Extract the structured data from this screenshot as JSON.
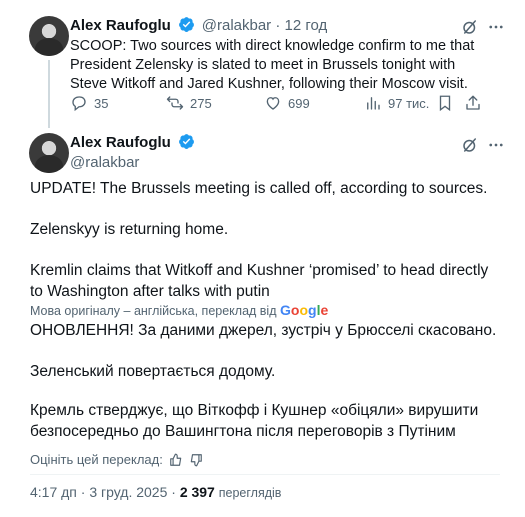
{
  "quoted_tweet": {
    "author_name": "Alex Raufoglu",
    "handle": "@ralakbar",
    "separator": " · ",
    "time": "12 год",
    "text": "SCOOP:  Two sources with direct knowledge confirm to me that President Zelensky is slated to meet in Brussels tonight with Steve Witkoff and Jared Kushner, following their Moscow visit.",
    "replies": "35",
    "reposts": "275",
    "likes": "699",
    "views": "97 тис."
  },
  "main_tweet": {
    "author_name": "Alex Raufoglu",
    "handle": "@ralakbar",
    "paragraphs": [
      "UPDATE!  The Brussels meeting is called off, according to sources.",
      "Zelenskyy is returning home.",
      "Kremlin claims that Witkoff and Kushner ‘promised’ to head directly to Washington after talks with putin"
    ],
    "translation_note": "Мова оригіналу – англійська, переклад від",
    "google_logo": "Google",
    "translated_paragraphs": [
      "ОНОВЛЕННЯ! За даними джерел, зустріч у Брюсселі скасовано.",
      "Зеленський повертається додому.",
      "Кремль стверджує, що Віткофф і Кушнер «обіцяли» вирушити безпосередньо до Вашингтона після переговорів з Путіним"
    ],
    "rate_translation": "Оцініть цей переклад:",
    "timestamp": "4:17 дп · 3 груд. 2025 ·",
    "views_count": "2 397",
    "views_label": "переглядів"
  },
  "colors": {
    "verified": "#1d9bf0",
    "secondary_text": "#536471",
    "primary_text": "#0f1419"
  },
  "icons": {
    "verified": "verified-badge-icon",
    "grok": "grok-icon",
    "more": "more-icon",
    "reply": "reply-icon",
    "repost": "repost-icon",
    "like": "like-icon",
    "views": "views-icon",
    "bookmark": "bookmark-icon",
    "share": "share-icon",
    "thumbs_up": "thumbs-up-icon",
    "thumbs_down": "thumbs-down-icon"
  }
}
